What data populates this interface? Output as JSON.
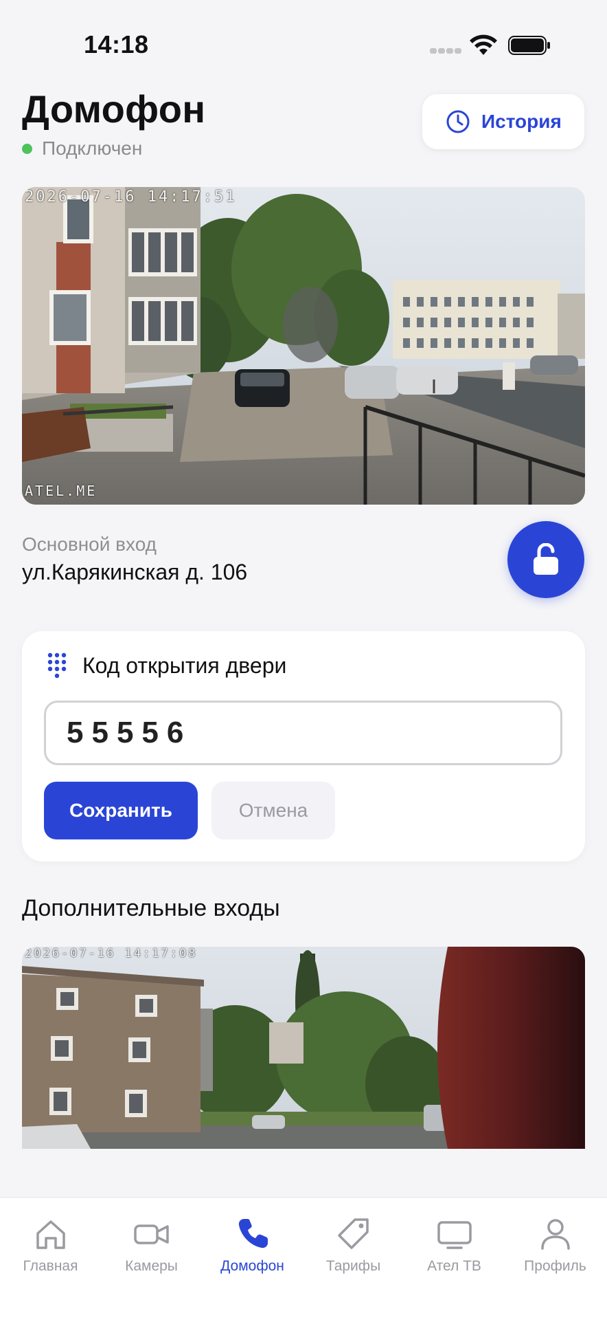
{
  "status_bar": {
    "time": "14:18"
  },
  "header": {
    "title": "Домофон",
    "status": "Подключен",
    "history_label": "История"
  },
  "main_camera": {
    "timestamp": "2026-07-16 14:17:51",
    "watermark": "ATEL.ME"
  },
  "entrance": {
    "name": "Основной вход",
    "address": "ул.Карякинская д. 106"
  },
  "door_code": {
    "title": "Код открытия двери",
    "value": "55556",
    "save_label": "Сохранить",
    "cancel_label": "Отмена"
  },
  "extra_entrances": {
    "title": "Дополнительные входы",
    "camera_timestamp": "2026-07-16 14:17:08"
  },
  "tabs": [
    {
      "label": "Главная",
      "icon": "home-icon"
    },
    {
      "label": "Камеры",
      "icon": "video-camera-icon"
    },
    {
      "label": "Домофон",
      "icon": "phone-icon",
      "active": true
    },
    {
      "label": "Тарифы",
      "icon": "tag-icon"
    },
    {
      "label": "Ател ТВ",
      "icon": "tv-icon"
    },
    {
      "label": "Профиль",
      "icon": "user-icon"
    }
  ],
  "colors": {
    "accent": "#2a45d6",
    "status_green": "#4cc35b",
    "background": "#f5f5f7"
  }
}
